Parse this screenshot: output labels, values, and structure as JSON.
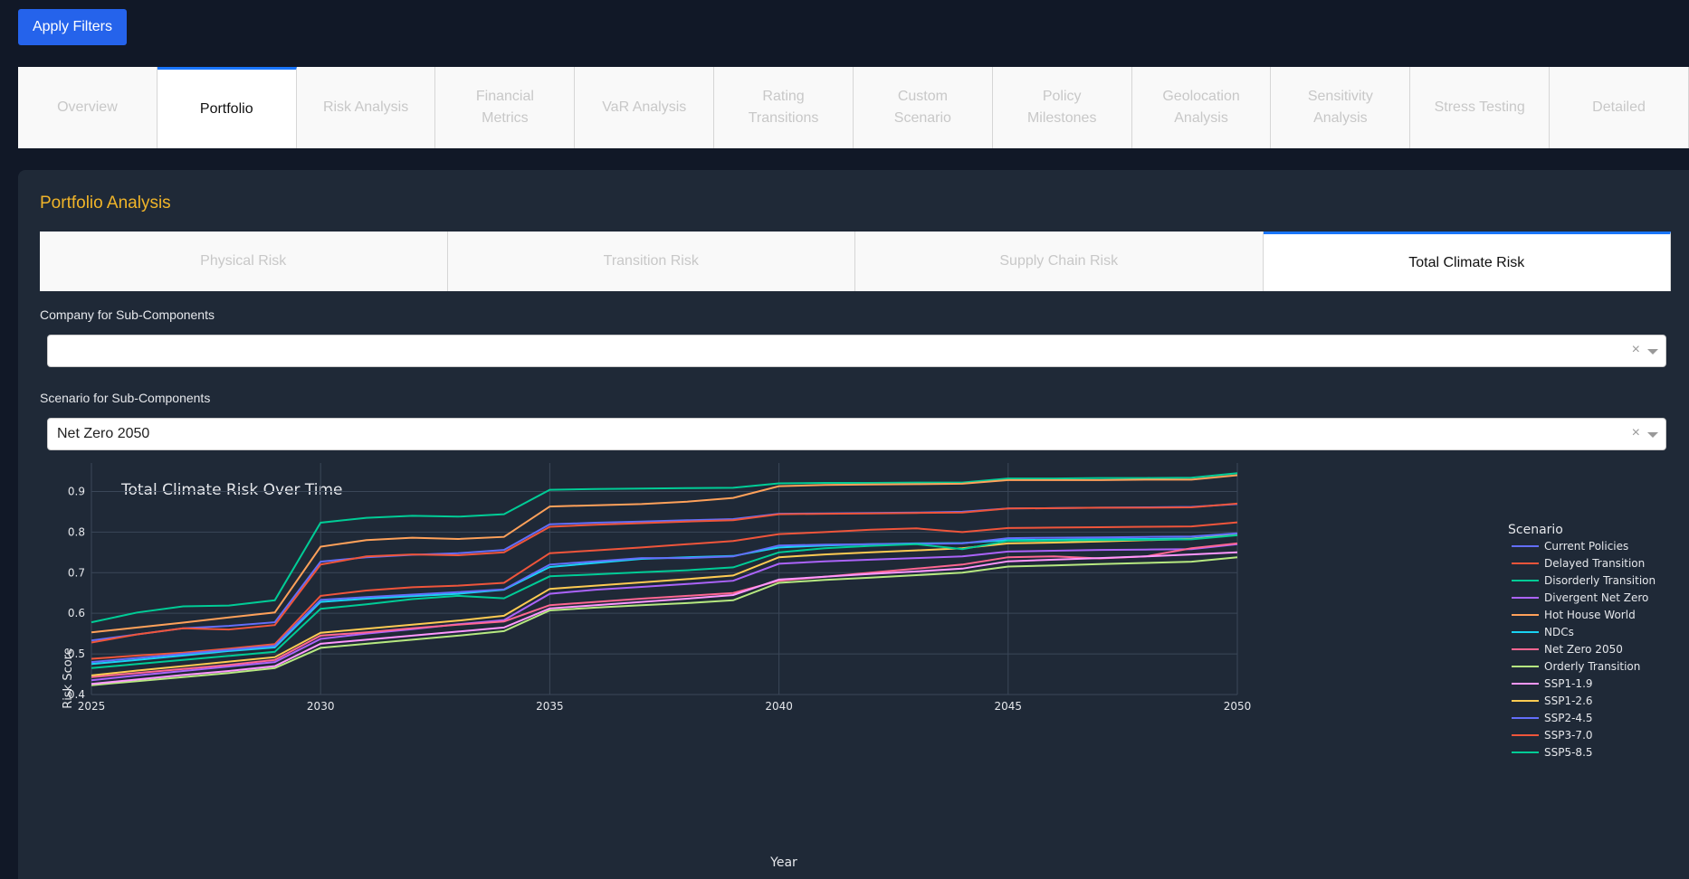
{
  "toolbar": {
    "apply_label": "Apply Filters"
  },
  "main_tabs": [
    {
      "label": "Overview",
      "active": false
    },
    {
      "label": "Portfolio",
      "active": true
    },
    {
      "label": "Risk Analysis",
      "active": false
    },
    {
      "label": "Financial\nMetrics",
      "active": false
    },
    {
      "label": "VaR Analysis",
      "active": false
    },
    {
      "label": "Rating\nTransitions",
      "active": false
    },
    {
      "label": "Custom\nScenario",
      "active": false
    },
    {
      "label": "Policy\nMilestones",
      "active": false
    },
    {
      "label": "Geolocation\nAnalysis",
      "active": false
    },
    {
      "label": "Sensitivity\nAnalysis",
      "active": false
    },
    {
      "label": "Stress Testing",
      "active": false
    },
    {
      "label": "Detailed",
      "active": false
    }
  ],
  "panel": {
    "title": "Portfolio Analysis"
  },
  "sub_tabs": [
    {
      "label": "Physical Risk",
      "active": false
    },
    {
      "label": "Transition Risk",
      "active": false
    },
    {
      "label": "Supply Chain Risk",
      "active": false
    },
    {
      "label": "Total Climate Risk",
      "active": true
    }
  ],
  "company_field": {
    "label": "Company for Sub-Components",
    "value": "",
    "clear": "×"
  },
  "scenario_field": {
    "label": "Scenario for Sub-Components",
    "value": "Net Zero 2050",
    "clear": "×"
  },
  "chart_data": {
    "type": "line",
    "title": "Total Climate Risk Over Time",
    "xlabel": "Year",
    "ylabel": "Risk Score",
    "xlim": [
      2025,
      2050
    ],
    "ylim": [
      0.4,
      0.97
    ],
    "xticks": [
      2025,
      2030,
      2035,
      2040,
      2045,
      2050
    ],
    "yticks": [
      0.4,
      0.5,
      0.6,
      0.7,
      0.8,
      0.9
    ],
    "grid": true,
    "legend_title": "Scenario",
    "legend_position": "right",
    "x": [
      2025,
      2026,
      2027,
      2028,
      2029,
      2030,
      2031,
      2032,
      2033,
      2034,
      2035,
      2036,
      2037,
      2038,
      2039,
      2040,
      2041,
      2042,
      2043,
      2044,
      2045,
      2046,
      2047,
      2048,
      2049,
      2050
    ],
    "series": [
      {
        "name": "Current Policies",
        "color": "#636efa",
        "values": [
          0.533,
          0.548,
          0.563,
          0.569,
          0.578,
          0.727,
          0.738,
          0.744,
          0.748,
          0.756,
          0.819,
          0.823,
          0.826,
          0.829,
          0.832,
          0.845,
          0.846,
          0.847,
          0.848,
          0.85,
          0.858,
          0.859,
          0.86,
          0.861,
          0.862,
          0.869
        ]
      },
      {
        "name": "Delayed Transition",
        "color": "#ef553b",
        "values": [
          0.488,
          0.496,
          0.503,
          0.513,
          0.524,
          0.643,
          0.656,
          0.664,
          0.668,
          0.675,
          0.748,
          0.755,
          0.762,
          0.77,
          0.778,
          0.795,
          0.8,
          0.806,
          0.809,
          0.8,
          0.81,
          0.811,
          0.812,
          0.813,
          0.814,
          0.824
        ]
      },
      {
        "name": "Disorderly Transition",
        "color": "#00cc96",
        "values": [
          0.578,
          0.602,
          0.617,
          0.619,
          0.632,
          0.823,
          0.835,
          0.84,
          0.838,
          0.844,
          0.904,
          0.906,
          0.907,
          0.908,
          0.909,
          0.92,
          0.921,
          0.921,
          0.922,
          0.922,
          0.932,
          0.932,
          0.933,
          0.933,
          0.934,
          0.945
        ]
      },
      {
        "name": "Divergent Net Zero",
        "color": "#ab63fa",
        "values": [
          0.435,
          0.447,
          0.458,
          0.469,
          0.48,
          0.537,
          0.55,
          0.561,
          0.573,
          0.583,
          0.648,
          0.658,
          0.665,
          0.672,
          0.68,
          0.722,
          0.728,
          0.732,
          0.736,
          0.74,
          0.752,
          0.754,
          0.756,
          0.757,
          0.758,
          0.77
        ]
      },
      {
        "name": "Hot House World",
        "color": "#ffa15a",
        "values": [
          0.553,
          0.565,
          0.577,
          0.59,
          0.602,
          0.764,
          0.78,
          0.786,
          0.783,
          0.788,
          0.863,
          0.866,
          0.869,
          0.875,
          0.884,
          0.913,
          0.916,
          0.917,
          0.918,
          0.919,
          0.928,
          0.928,
          0.928,
          0.929,
          0.929,
          0.94
        ]
      },
      {
        "name": "NDCs",
        "color": "#19d3f3",
        "values": [
          0.475,
          0.485,
          0.496,
          0.507,
          0.516,
          0.628,
          0.636,
          0.642,
          0.648,
          0.658,
          0.714,
          0.724,
          0.734,
          0.738,
          0.741,
          0.762,
          0.767,
          0.77,
          0.772,
          0.773,
          0.78,
          0.781,
          0.782,
          0.783,
          0.784,
          0.794
        ]
      },
      {
        "name": "Net Zero 2050",
        "color": "#ff6692",
        "values": [
          0.443,
          0.453,
          0.463,
          0.473,
          0.485,
          0.545,
          0.553,
          0.563,
          0.572,
          0.58,
          0.62,
          0.628,
          0.636,
          0.643,
          0.65,
          0.68,
          0.69,
          0.7,
          0.71,
          0.72,
          0.738,
          0.74,
          0.735,
          0.74,
          0.76,
          0.772
        ]
      },
      {
        "name": "Orderly Transition",
        "color": "#b6e880",
        "values": [
          0.423,
          0.433,
          0.443,
          0.453,
          0.465,
          0.515,
          0.525,
          0.535,
          0.545,
          0.556,
          0.607,
          0.614,
          0.62,
          0.625,
          0.632,
          0.675,
          0.682,
          0.688,
          0.694,
          0.7,
          0.715,
          0.718,
          0.721,
          0.724,
          0.727,
          0.738
        ]
      },
      {
        "name": "SSP1-1.9",
        "color": "#ff97ff",
        "values": [
          0.426,
          0.437,
          0.448,
          0.458,
          0.47,
          0.525,
          0.535,
          0.545,
          0.555,
          0.565,
          0.612,
          0.62,
          0.628,
          0.636,
          0.645,
          0.683,
          0.69,
          0.697,
          0.703,
          0.71,
          0.728,
          0.732,
          0.736,
          0.74,
          0.745,
          0.75
        ]
      },
      {
        "name": "SSP1-2.6",
        "color": "#fecb52",
        "values": [
          0.447,
          0.459,
          0.47,
          0.481,
          0.492,
          0.552,
          0.562,
          0.572,
          0.582,
          0.594,
          0.66,
          0.668,
          0.676,
          0.684,
          0.693,
          0.738,
          0.745,
          0.75,
          0.755,
          0.76,
          0.772,
          0.774,
          0.777,
          0.78,
          0.783,
          0.793
        ]
      },
      {
        "name": "SSP2-4.5",
        "color": "#636efa",
        "values": [
          0.48,
          0.49,
          0.5,
          0.51,
          0.52,
          0.633,
          0.64,
          0.646,
          0.652,
          0.659,
          0.72,
          0.728,
          0.736,
          0.736,
          0.74,
          0.767,
          0.769,
          0.77,
          0.771,
          0.772,
          0.785,
          0.786,
          0.787,
          0.788,
          0.789,
          0.797
        ]
      },
      {
        "name": "SSP3-7.0",
        "color": "#ef553b",
        "values": [
          0.528,
          0.548,
          0.563,
          0.56,
          0.571,
          0.72,
          0.74,
          0.745,
          0.743,
          0.75,
          0.813,
          0.818,
          0.822,
          0.826,
          0.829,
          0.844,
          0.845,
          0.846,
          0.847,
          0.848,
          0.858,
          0.859,
          0.86,
          0.86,
          0.861,
          0.87
        ]
      },
      {
        "name": "SSP5-8.5",
        "color": "#00cc96",
        "values": [
          0.465,
          0.475,
          0.485,
          0.495,
          0.505,
          0.611,
          0.622,
          0.635,
          0.643,
          0.637,
          0.691,
          0.696,
          0.701,
          0.706,
          0.713,
          0.75,
          0.76,
          0.766,
          0.77,
          0.758,
          0.778,
          0.779,
          0.78,
          0.781,
          0.782,
          0.792
        ]
      }
    ]
  }
}
